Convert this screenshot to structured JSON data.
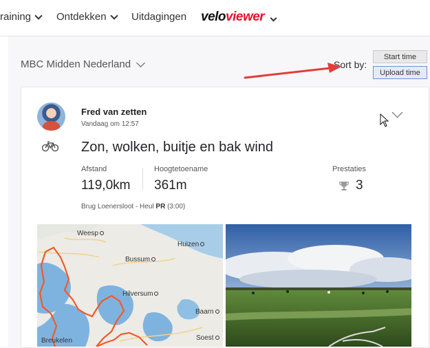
{
  "nav": {
    "items": [
      {
        "label": "raining",
        "dropdown": true
      },
      {
        "label": "Ontdekken",
        "dropdown": true
      },
      {
        "label": "Uitdagingen",
        "dropdown": false
      }
    ],
    "logo": {
      "part1": "velo",
      "part2": "viewer"
    }
  },
  "filter": {
    "club": "MBC Midden Nederland"
  },
  "sort": {
    "label": "Sort by:",
    "start_time": "Start time",
    "upload_time": "Upload time",
    "selected": "Upload time"
  },
  "activity": {
    "athlete": "Fred van zetten",
    "timestamp": "Vandaag om 12:57",
    "title": "Zon, wolken, buitje en bak wind",
    "stats": {
      "distance_label": "Afstand",
      "distance_value": "119,0km",
      "elevation_label": "Hoogtetoename",
      "elevation_value": "361m",
      "achievements_label": "Prestaties",
      "achievements_value": "3"
    },
    "segment": {
      "name": "Brug Loenersloot - Heul",
      "pr": "PR",
      "time": "(3:00)"
    },
    "map_towns": [
      "Weesp",
      "Huizen",
      "Bussum",
      "Hilversum",
      "Baarn",
      "Breukelen",
      "Soest"
    ]
  },
  "colors": {
    "accent": "#6f8fd6",
    "route": "#f05a28",
    "water": "#7fb3df",
    "logo_red": "#e8112d"
  },
  "icons": [
    "chevron-down-icon",
    "bike-icon",
    "trophy-icon",
    "cursor-icon",
    "red-arrow-annotation"
  ]
}
